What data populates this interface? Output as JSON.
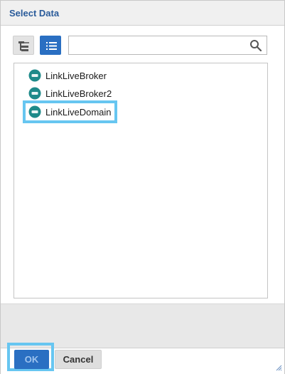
{
  "dialog": {
    "title": "Select Data"
  },
  "toolbar": {
    "tree_view_icon": "tree-view-icon",
    "list_view_icon": "list-view-icon"
  },
  "search": {
    "value": "",
    "placeholder": "",
    "icon": "search-icon"
  },
  "list": {
    "items": [
      {
        "label": "LinkLiveBroker",
        "icon": "data-source-icon",
        "selected": false
      },
      {
        "label": "LinkLiveBroker2",
        "icon": "data-source-icon",
        "selected": false
      },
      {
        "label": "LinkLiveDomain",
        "icon": "data-source-icon",
        "selected": true
      }
    ]
  },
  "footer": {
    "ok_label": "OK",
    "cancel_label": "Cancel"
  },
  "colors": {
    "accent": "#2a6fc2",
    "highlight": "#67c6f1",
    "title": "#2a5b9a",
    "item_icon": "#1e8a8a"
  }
}
